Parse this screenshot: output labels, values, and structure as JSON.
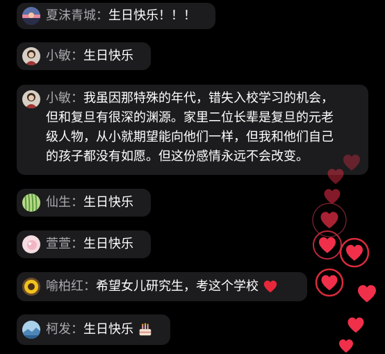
{
  "comments": [
    {
      "name": "夏沫青城：",
      "text": "生日快乐！！！"
    },
    {
      "name": "小敏：",
      "text": "生日快乐"
    },
    {
      "name": "小敏：",
      "lines": [
        "我虽因那特殊的年代，错失入校学习的机会，",
        "但和复旦有很深的渊源。家里二位长辈是复旦的元老",
        "级人物，从小就期望能向他们一样，但我和他们自己",
        "的孩子都没有如愿。但这份感情永远不会改变。"
      ]
    },
    {
      "name": "仙生：",
      "text": "生日快乐"
    },
    {
      "name": "萱萱：",
      "text": "生日快乐"
    },
    {
      "name": "喻柏红：",
      "text": "希望女儿研究生，考这个学校",
      "emoji": "heart-emoji"
    },
    {
      "name": "柯发：",
      "text": "生日快乐",
      "emoji": "birthday-cake-emoji"
    }
  ],
  "colors": {
    "background": "#000000",
    "bubble": "#1c1c1e",
    "name": "#a9a9ae",
    "text": "#ffffff",
    "heart": "#f0304a"
  },
  "icons": {
    "avatars": [
      "sunset-avatar",
      "person-avatar",
      "person-avatar",
      "willow-avatar",
      "pink-avatar",
      "sunflower-avatar",
      "landscape-avatar"
    ],
    "overlay": "floating-hearts"
  }
}
